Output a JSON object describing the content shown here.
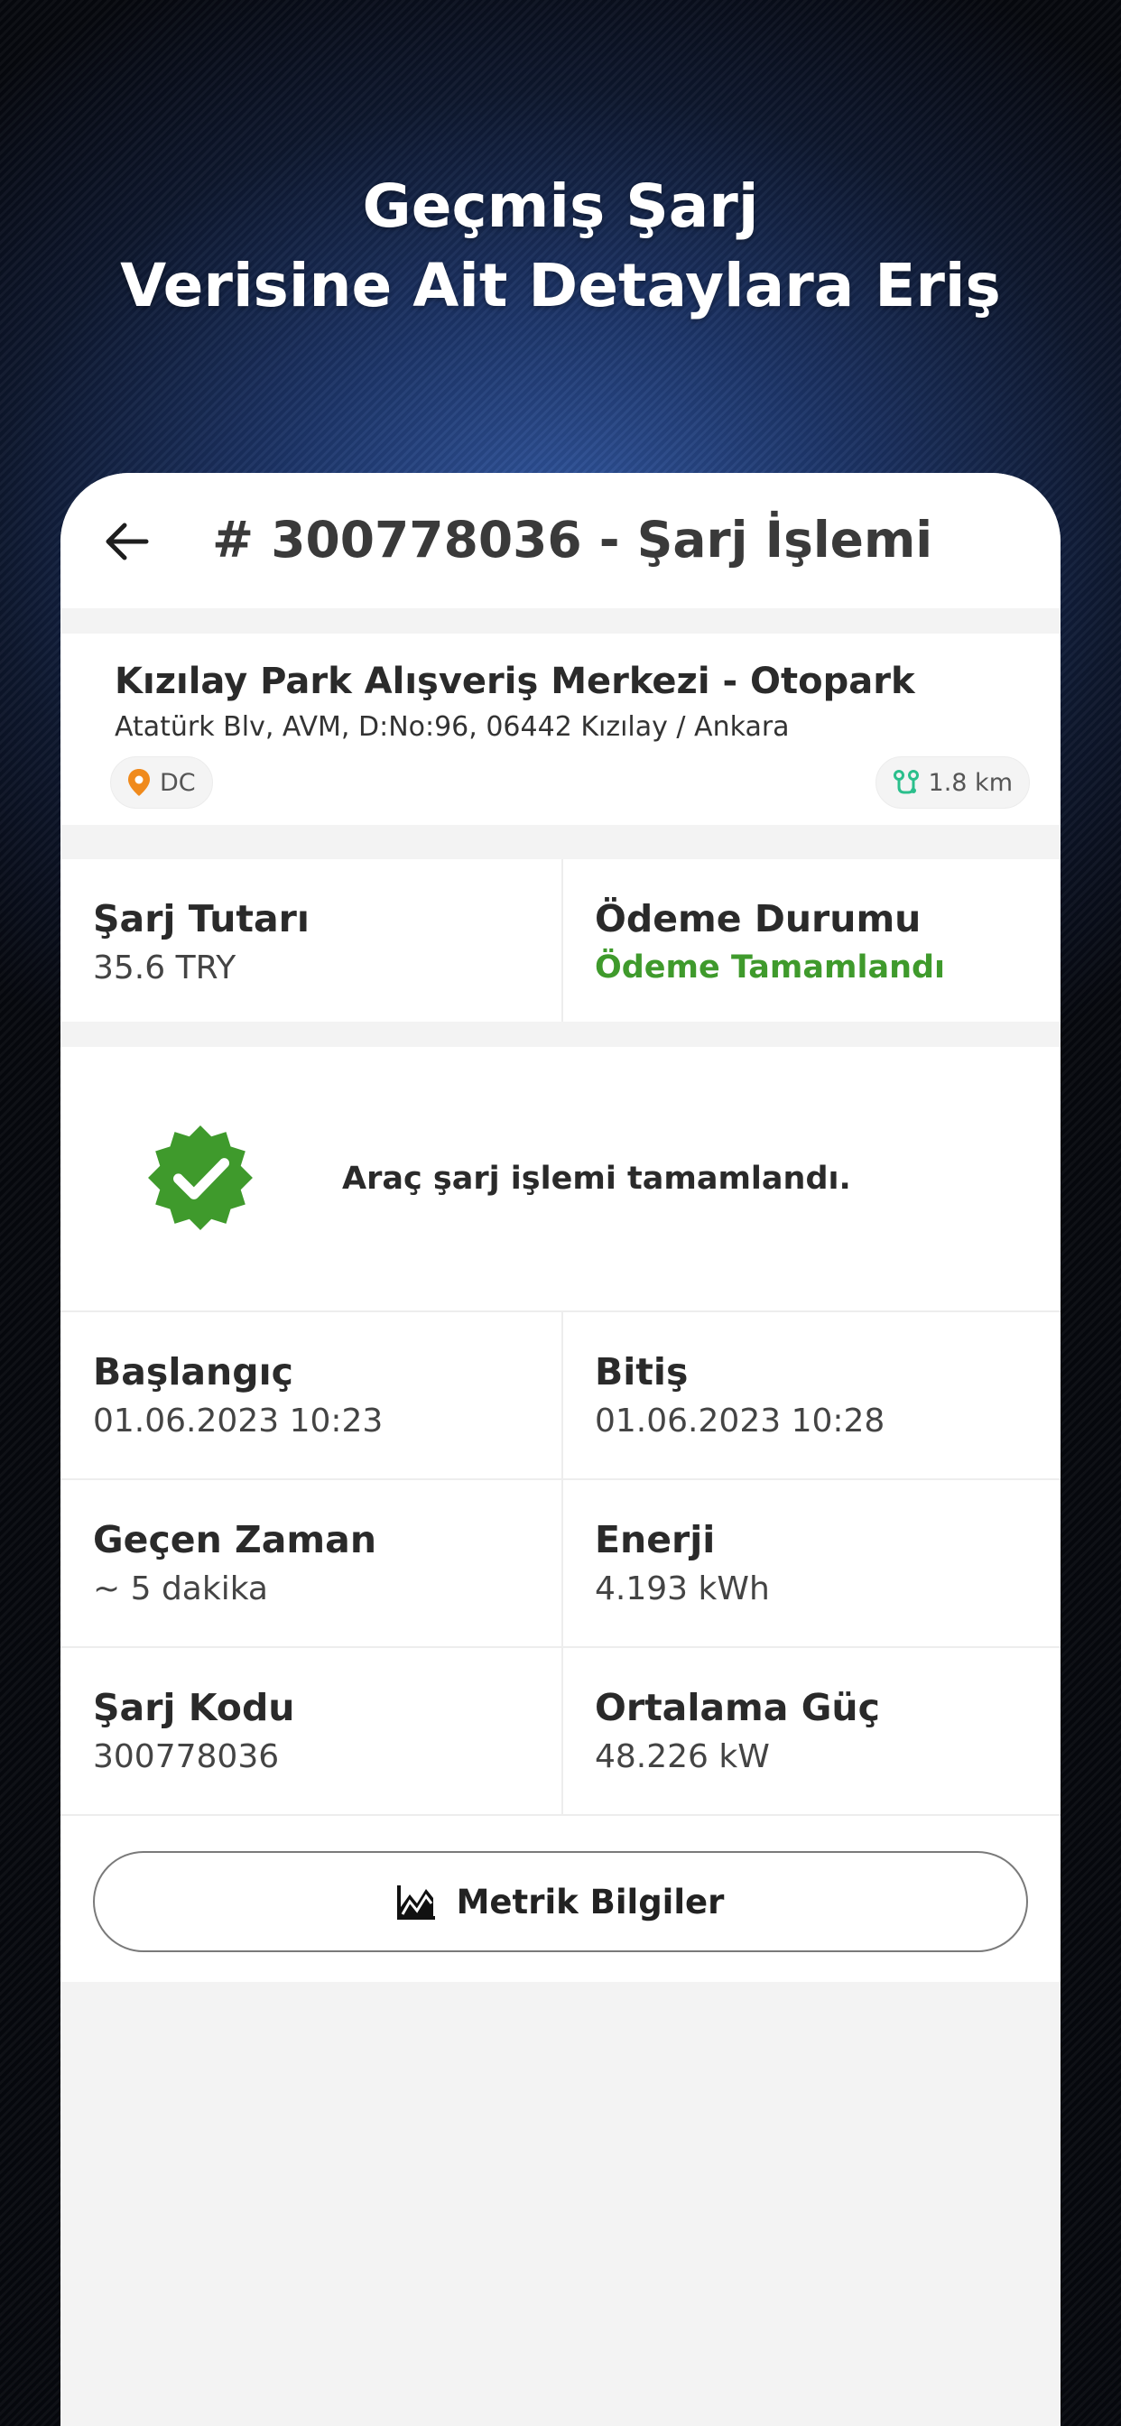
{
  "hero": {
    "line1": "Geçmiş Şarj",
    "line2": "Verisine Ait Detaylara Eriş"
  },
  "header": {
    "title": "# 300778036 - Şarj İşlemi",
    "back_icon": "arrow-left-icon"
  },
  "station": {
    "name": "Kızılay Park Alışveriş Merkezi - Otopark",
    "address": "Atatürk Blv, AVM, D:No:96, 06442 Kızılay / Ankara",
    "type": "DC",
    "distance": "1.8 km",
    "type_icon": "location-pin-icon",
    "distance_icon": "route-icon",
    "colors": {
      "pin": "#f08a1c",
      "route": "#2bbf8c"
    }
  },
  "payment": {
    "amount_label": "Şarj Tutarı",
    "amount_value": "35.6 TRY",
    "status_label": "Ödeme Durumu",
    "status_value": "Ödeme Tamamlandı",
    "status_color": "#3f9a2c"
  },
  "completion": {
    "icon": "verified-badge-icon",
    "message": "Araç şarj işlemi tamamlandı.",
    "color": "#3f9a2c"
  },
  "details": [
    {
      "left_label": "Başlangıç",
      "left_value": "01.06.2023 10:23",
      "right_label": "Bitiş",
      "right_value": "01.06.2023 10:28"
    },
    {
      "left_label": "Geçen Zaman",
      "left_value": "~  5 dakika",
      "right_label": "Enerji",
      "right_value": "4.193 kWh"
    },
    {
      "left_label": "Şarj Kodu",
      "left_value": "300778036",
      "right_label": "Ortalama Güç",
      "right_value": "48.226 kW"
    }
  ],
  "metric_button": {
    "label": "Metrik Bilgiler",
    "icon": "area-chart-icon"
  }
}
